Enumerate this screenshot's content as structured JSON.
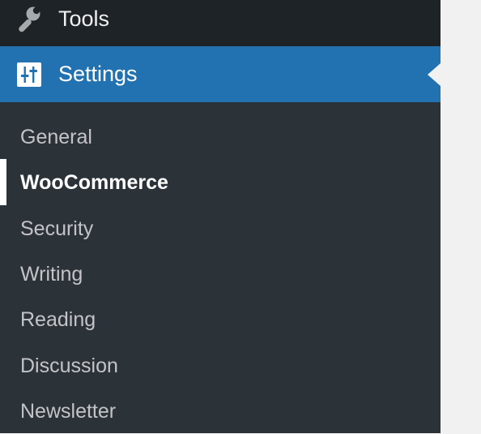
{
  "menu": {
    "tools": {
      "label": "Tools",
      "icon": "wrench-icon"
    },
    "settings": {
      "label": "Settings",
      "icon": "settings-sliders-icon",
      "current": true
    }
  },
  "submenu": {
    "items": [
      {
        "label": "General"
      },
      {
        "label": "WooCommerce",
        "current": true
      },
      {
        "label": "Security"
      },
      {
        "label": "Writing"
      },
      {
        "label": "Reading"
      },
      {
        "label": "Discussion"
      },
      {
        "label": "Newsletter"
      }
    ]
  },
  "colors": {
    "menu_bg": "#1d2327",
    "submenu_bg": "#2c3338",
    "active_bg": "#2271b1",
    "content_bg": "#f1f1f1",
    "text": "#f0f0f1",
    "submenu_text": "#c3c4c7",
    "current_text": "#ffffff"
  }
}
